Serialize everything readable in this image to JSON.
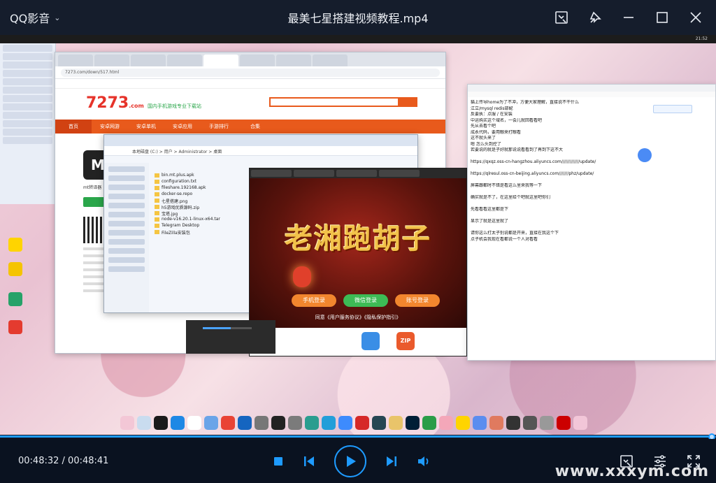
{
  "app": {
    "name": "QQ影音"
  },
  "video": {
    "title": "最美七星搭建视频教程.mp4"
  },
  "playback": {
    "current_time": "00:48:32",
    "separator": " / ",
    "total_time": "00:48:41",
    "progress_fraction": 0.9969
  },
  "frame": {
    "clock": "21:52",
    "site_slogan": "国内手机游戏专业下载站",
    "site_nav": [
      "首页",
      "安卓网游",
      "安卓单机",
      "安卓应用",
      "手游排行",
      "合集"
    ],
    "site_url": "7273.com/down/517.html",
    "app_label": "mt转译器",
    "app_initial": "M",
    "explorer_path": "本地磁盘 (C:) > 用户 > Administrator > 桌面",
    "files": [
      "bin.mt.plus.apk",
      "configuration.txt",
      "fileshare.192168.apk",
      "docker-se.repo",
      "七星搭建.png",
      "h5游戏优质源码.zip",
      "宝塔.jpg",
      "node-v16.20.1-linux-x64.tar",
      "Telegram Desktop",
      "FileZilla安装包"
    ],
    "game_title": "老湘跑胡子",
    "game_phone_login": "手机登录",
    "game_wechat_login": "微信登录",
    "game_account_login": "账号登录",
    "game_agreement": "同意《用户服务协议》《隐私保护指引》",
    "zip_label": "ZIP",
    "notepad_lines": [
      "猫上传导home为了不冲，方便大家理解，直接说不干什么",
      "江立/mysql redis部配",
      "反要执：点服 / 在安装",
      "中运购买这个域名，一会儿就回看看吧",
      "先从去看个吧",
      "成永代码，要用眼来打眼看",
      "这不就头来了",
      "嗯 怎么头到控了",
      "若要说的就是子好就那说说看看到了再到下这不大",
      "",
      "https://qxqz.oss-cn-hangzhou.aliyuncs.com/////////////update/",
      "",
      "https://qlresul.oss-cn-beijing.aliyuncs.com///////phz/update/",
      "",
      "屏幕跟都时不错是看这么里来我等一下",
      "",
      "确实就是不了，在这里给个吧就这里吧你们",
      "",
      "先看看看这里都是下",
      "",
      "显示了就是这里就了",
      "",
      "请你这么打太子别说都是开来，直接在我这个下",
      "点子机会我现在看都说一个人对看看"
    ]
  },
  "watermark": "www.xxxym.com",
  "icons": {
    "chevron": "chevron-down-icon",
    "screenshot": "screenshot-icon",
    "pin": "pin-icon",
    "minimize": "minimize-icon",
    "maximize": "maximize-icon",
    "close": "close-icon",
    "stop": "stop-icon",
    "previous": "previous-icon",
    "play": "play-icon",
    "next": "next-icon",
    "volume": "volume-icon",
    "snapshot": "snapshot-icon",
    "settings": "settings-sliders-icon",
    "fullscreen": "fullscreen-icon"
  },
  "colors": {
    "accent": "#1e9bff",
    "titlebar": "#151d2c",
    "controls_bg": "#0a1220"
  }
}
